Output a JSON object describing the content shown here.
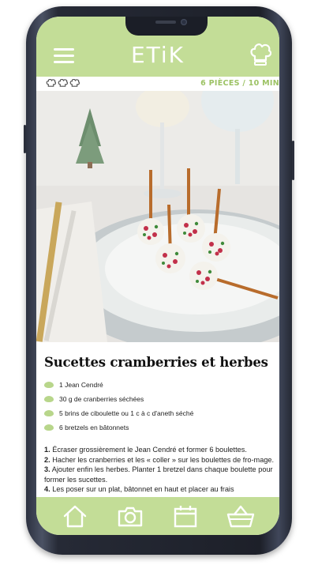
{
  "app": {
    "logo_text": "ETiK",
    "brand_color": "#c3dd97",
    "accent_text_color": "#9cc264"
  },
  "header": {
    "menu_icon": "menu-icon",
    "chef_icon": "chef-hat-icon"
  },
  "recipe": {
    "difficulty_icons": [
      "chef-hat-icon",
      "chef-hat-icon",
      "chef-hat-icon"
    ],
    "meta": "6 PIÈCES / 10 MIN",
    "title": "Sucettes cramberries et herbes",
    "ingredients": [
      "1 Jean Cendré",
      "30 g de cranberries séchées",
      "5 brins de ciboulette ou 1 c à c d'aneth séché",
      "6 bretzels en bâtonnets"
    ],
    "steps": [
      {
        "num": "1.",
        "text": " Écraser grossièrement le Jean Cendré et former 6 boulettes."
      },
      {
        "num": "2.",
        "text": " Hacher les cranberries et les « coller » sur les boulettes de fro-mage."
      },
      {
        "num": "3.",
        "text": " Ajouter enfin les herbes. Planter 1 bretzel dans chaque boulette pour former les sucettes."
      },
      {
        "num": "4.",
        "text": " Les poser sur un plat, bâtonnet en haut et placer au frais"
      }
    ]
  },
  "bottom_nav": [
    {
      "icon": "home-icon"
    },
    {
      "icon": "camera-icon"
    },
    {
      "icon": "calendar-icon"
    },
    {
      "icon": "basket-icon"
    }
  ]
}
